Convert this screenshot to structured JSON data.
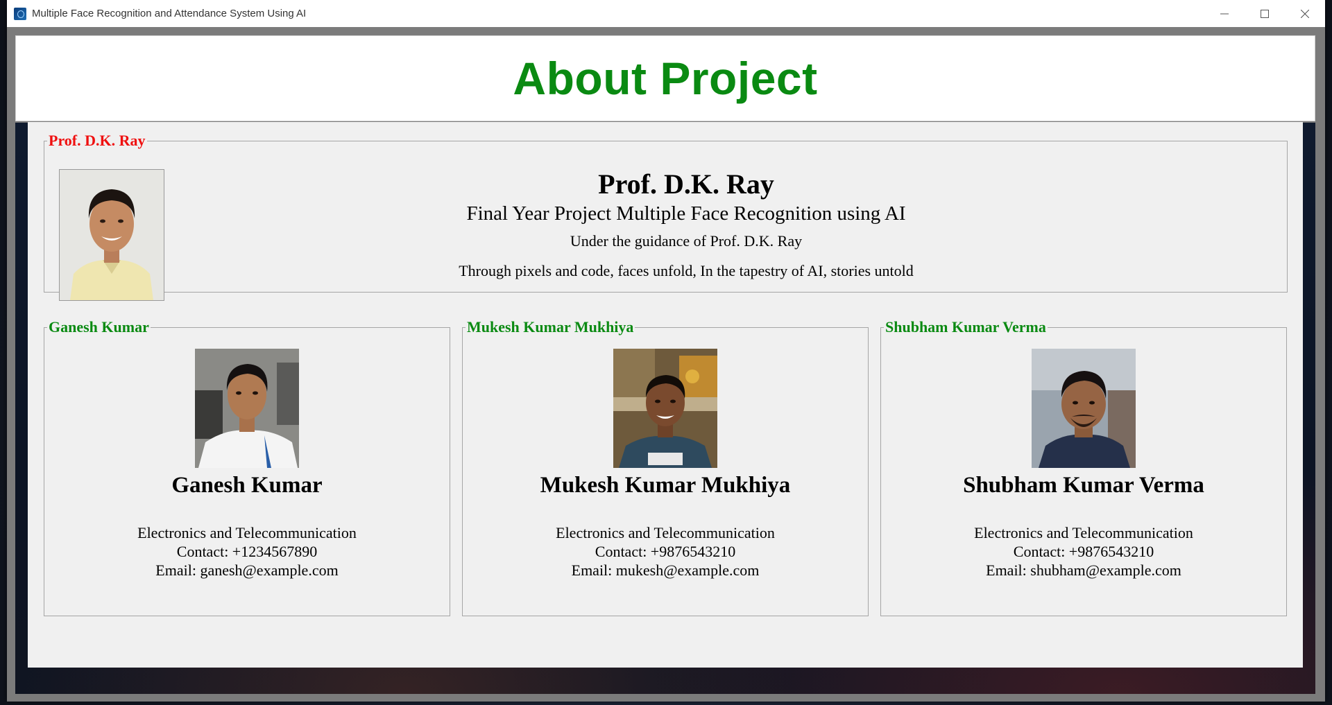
{
  "window": {
    "title": "Multiple Face Recognition and Attendance System Using AI"
  },
  "header": {
    "title": "About Project"
  },
  "guide": {
    "legend": "Prof. D.K. Ray",
    "name": "Prof. D.K. Ray",
    "subtitle": "Final Year Project Multiple Face Recognition using AI",
    "guidance": "Under the guidance of Prof. D.K. Ray",
    "quote": "Through pixels and code, faces unfold, In the tapestry of AI, stories untold"
  },
  "members": [
    {
      "legend": "Ganesh Kumar",
      "name": "Ganesh Kumar",
      "department": "Electronics and Telecommunication",
      "contact": "Contact: +1234567890",
      "email": "Email: ganesh@example.com"
    },
    {
      "legend": "Mukesh Kumar Mukhiya",
      "name": "Mukesh Kumar Mukhiya",
      "department": "Electronics and Telecommunication",
      "contact": "Contact: +9876543210",
      "email": "Email: mukesh@example.com"
    },
    {
      "legend": "Shubham Kumar Verma",
      "name": "Shubham Kumar Verma",
      "department": "Electronics and Telecommunication",
      "contact": "Contact: +9876543210",
      "email": "Email: shubham@example.com"
    }
  ],
  "colors": {
    "title_green": "#0a8a12",
    "legend_red": "#ef1010",
    "legend_green": "#0a8a12",
    "panel_bg": "#f0f0f0"
  },
  "icons": {
    "minimize": "minimize-icon",
    "maximize": "maximize-icon",
    "close": "close-icon"
  }
}
